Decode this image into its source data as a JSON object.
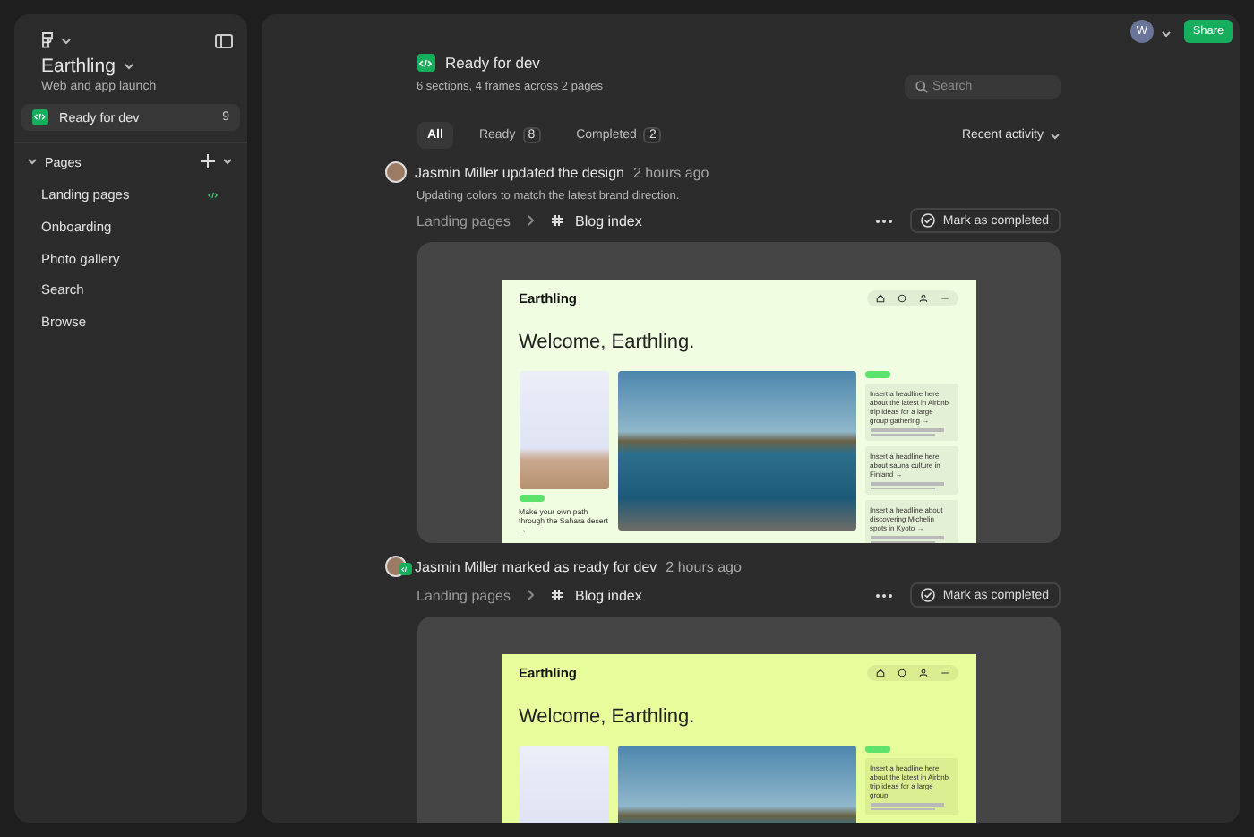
{
  "sidebar": {
    "project": "Earthling",
    "subtitle": "Web and app launch",
    "ready": {
      "label": "Ready for dev",
      "count": "9"
    },
    "pages_title": "Pages",
    "pages": [
      {
        "label": "Landing pages",
        "dev": true
      },
      {
        "label": "Onboarding",
        "dev": false
      },
      {
        "label": "Photo gallery",
        "dev": false
      },
      {
        "label": "Search",
        "dev": false
      },
      {
        "label": "Browse",
        "dev": false
      }
    ]
  },
  "topbar": {
    "avatar": "W",
    "share": "Share"
  },
  "header": {
    "title": "Ready for dev",
    "summary": "6 sections, 4 frames across 2 pages",
    "search": {
      "placeholder": "Search"
    }
  },
  "tabs": [
    {
      "label": "All",
      "selected": true
    },
    {
      "label": "Ready",
      "count": "8",
      "selected": false
    },
    {
      "label": "Completed",
      "count": "2",
      "selected": false
    }
  ],
  "sort": "Recent activity",
  "activities": [
    {
      "actor": "Jasmin Miller",
      "action": "updated the design",
      "time": "2 hours ago",
      "ready_badge": false,
      "description": "Updating colors to match the latest brand direction.",
      "page": "Landing pages",
      "frame": "Blog index",
      "button": "Mark as completed",
      "preview": {
        "color": "#f1fde1",
        "logo": "Earthling",
        "heading": "Welcome, Earthling.",
        "caption": "Make your own path through the Sahara desert →",
        "headlines": [
          "Insert a headline here about the latest in Airbnb trip ideas for a large group gathering →",
          "Insert a headline here about sauna culture in Finland →",
          "Insert a headline about discovering Michelin spots in Kyoto →"
        ]
      }
    },
    {
      "actor": "Jasmin Miller",
      "action": "marked as ready for dev",
      "time": "2 hours ago",
      "ready_badge": true,
      "page": "Landing pages",
      "frame": "Blog index",
      "button": "Mark as completed",
      "preview": {
        "color": "#e7fc9a",
        "logo": "Earthling",
        "heading": "Welcome, Earthling.",
        "headlines": [
          "Insert a headline here about the latest in Airbnb trip ideas for a large group"
        ]
      }
    }
  ]
}
